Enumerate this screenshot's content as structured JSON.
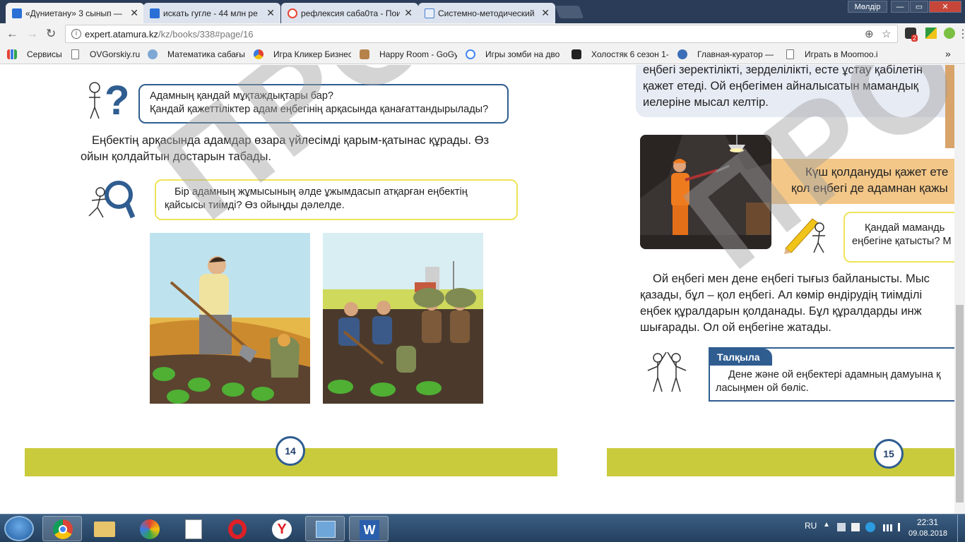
{
  "browser": {
    "tabs": [
      {
        "title": "«Дүниетану» 3 сынып —",
        "close": "✕",
        "active": true,
        "color": "#2a6fd6"
      },
      {
        "title": "искать гугле - 44 млн ре",
        "close": "✕",
        "active": false,
        "color": "#2a6fd6"
      },
      {
        "title": "рефлексия саба0та - Пои",
        "close": "✕",
        "active": false,
        "color": "#ea4335"
      },
      {
        "title": "Системно-методический",
        "close": "✕",
        "active": false,
        "color": "#4a7fcf"
      }
    ],
    "user": "Мөлдір",
    "window_buttons": {
      "minimize": "—",
      "maximize": "▭",
      "close": "✕"
    },
    "nav": {
      "back": "←",
      "forward": "→",
      "reload": "↻"
    },
    "url_host": "expert.atamura.kz",
    "url_path": "/kz/books/338#page/16",
    "omnibox_icons": {
      "info": "i",
      "zoom": "⊕",
      "star": "☆"
    },
    "extension_badge": "2",
    "menu": "⋮",
    "bookmarks": [
      {
        "label": "Сервисы",
        "icon": "apps-icon"
      },
      {
        "label": "OVGorskiy.ru",
        "icon": "page-icon"
      },
      {
        "label": "Математика сабағы",
        "icon": "site-icon"
      },
      {
        "label": "Игра Кликер Бизнес",
        "icon": "site-icon"
      },
      {
        "label": "Happy Room - GoGy",
        "icon": "site-icon"
      },
      {
        "label": "Игры зомби на дво",
        "icon": "google-icon"
      },
      {
        "label": "Холостяк 6 сезон 1-",
        "icon": "site-icon"
      },
      {
        "label": "Главная-куратор —",
        "icon": "site-icon"
      },
      {
        "label": "Играть в Moomoo.io",
        "icon": "page-icon"
      }
    ],
    "bookmarks_more": "»"
  },
  "book": {
    "left_page": {
      "question_bubble": {
        "line1": "Адамның қандай мұқтаждықтары бар?",
        "line2": "Қандай қажеттіліктер адам еңбегінің арқасында қанағаттандырылады?"
      },
      "paragraph_line1": "Еңбектің арқасында адамдар өзара үйлесімді қарым-қатынас құрады. Өз",
      "paragraph_line2": "ойын қолдайтын достарын табады.",
      "task_bubble_line1": "Бір адамның жұмысының әлде ұжымдасып атқарған еңбектің",
      "task_bubble_line2": "қайсысы тиімді? Өз ойыңды дәлелде.",
      "page_number": "14"
    },
    "right_page": {
      "top_box_line1": "еңбегі зеректілікті, зерделілікті, есте ұстау қабілетін",
      "top_box_line2": "қажет етеді. Ой еңбегімен айналысатын мамандық",
      "top_box_line3": "иелеріне мысал келтір.",
      "banner_line1": "Күш қолдануды қажет ете",
      "banner_line2": "қол еңбегі де адамнан қажы",
      "question_line1": "Қандай мамандь",
      "question_line2": "еңбегіне қатысты? М",
      "paragraph_line1": "Ой еңбегі мен дене еңбегі тығыз байланысты. Мыс",
      "paragraph_line2": "қазады, бұл – қол еңбегі. Ал көмір өндірудің тиімділі",
      "paragraph_line3": "еңбек құралдарын қолданады. Бұл құралдарды инж",
      "paragraph_line4": "шығарады. Ол ой еңбегіне жатады.",
      "discuss_label": "Талқыла",
      "discuss_line1": "Дене және ой еңбектері адамның дамуына қ",
      "discuss_line2": "ласыңмен ой бөліс.",
      "page_number": "15"
    },
    "watermark": "ПРОБ",
    "colors": {
      "footer": "#c9cb3c",
      "accent_blue": "#2f5d90",
      "bubble_yellow": "#efe35a"
    }
  },
  "taskbar": {
    "apps": [
      "chrome-icon",
      "explorer-icon",
      "paint-icon",
      "notepad-icon",
      "opera-icon",
      "yandex-icon",
      "control-panel-icon",
      "word-icon"
    ],
    "lang": "RU",
    "time": "22:31",
    "date": "09.08.2018"
  }
}
